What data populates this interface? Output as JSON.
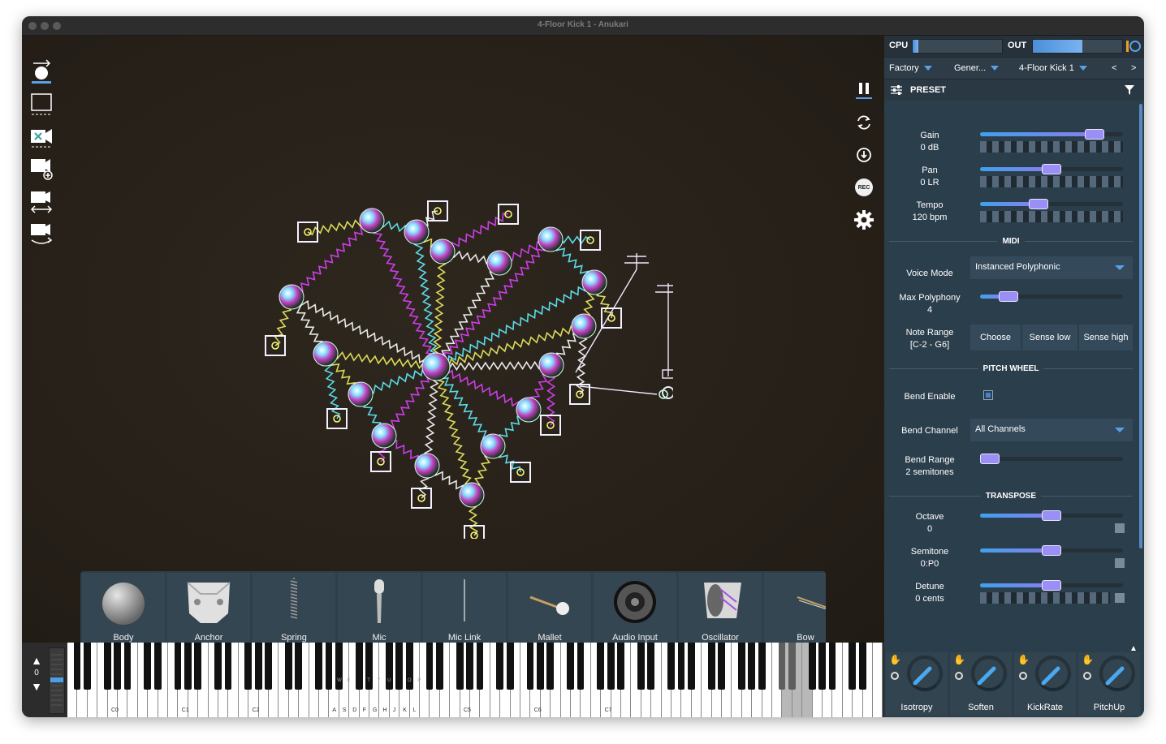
{
  "window": {
    "title": "4-Floor Kick 1 - Anukari"
  },
  "left_toolbar": {
    "items": [
      "select-tool",
      "box-select-tool",
      "camera-focus",
      "camera-add",
      "camera-pan",
      "camera-orbit"
    ]
  },
  "right_toolbar": {
    "pause_icon": "pause-icon",
    "reset_icon": "reset-icon",
    "follow_icon": "follow-icon",
    "rec_label": "REC",
    "settings_icon": "gear-icon"
  },
  "palette": {
    "items": [
      {
        "label": "Body",
        "icon": "sphere-icon"
      },
      {
        "label": "Anchor",
        "icon": "anchor-icon"
      },
      {
        "label": "Spring",
        "icon": "spring-icon"
      },
      {
        "label": "Mic",
        "icon": "mic-icon"
      },
      {
        "label": "Mic Link",
        "icon": "mic-link-icon"
      },
      {
        "label": "Mallet",
        "icon": "mallet-icon"
      },
      {
        "label": "Audio Input",
        "icon": "speaker-icon"
      },
      {
        "label": "Oscillator",
        "icon": "oscillator-icon"
      },
      {
        "label": "Bow",
        "icon": "bow-icon"
      }
    ],
    "scroll_fraction": 0.38
  },
  "keyboard": {
    "octave_value": "0",
    "octave_labels": [
      "C0",
      "C1",
      "C2",
      "C5",
      "C6",
      "C7"
    ],
    "letter_labels": [
      "A",
      "S",
      "D",
      "F",
      "G",
      "H",
      "J",
      "K",
      "L"
    ],
    "black_letter_labels": [
      "W",
      "E",
      "T",
      "Y",
      "U",
      "O",
      "P"
    ]
  },
  "side": {
    "cpu_label": "CPU",
    "out_label": "OUT",
    "cpu_level": 0.06,
    "out_level": 0.55,
    "preset_bank": "Factory",
    "preset_category": "Gener...",
    "preset_name": "4-Floor Kick 1",
    "prev_label": "<",
    "next_label": ">",
    "section_title": "PRESET",
    "gain": {
      "label": "Gain",
      "value": "0 dB",
      "fraction": 0.8
    },
    "pan": {
      "label": "Pan",
      "value": "0 LR",
      "fraction": 0.5
    },
    "tempo": {
      "label": "Tempo",
      "value": "120 bpm",
      "fraction": 0.41
    },
    "midi_header": "MIDI",
    "voice_mode": {
      "label": "Voice Mode",
      "value": "Instanced Polyphonic"
    },
    "max_polyphony": {
      "label": "Max Polyphony",
      "value": "4",
      "fraction": 0.2
    },
    "note_range": {
      "label": "Note Range",
      "value": "[C-2 - G6]",
      "choose": "Choose",
      "sense_low": "Sense low",
      "sense_high": "Sense high"
    },
    "pitch_wheel_header": "PITCH WHEEL",
    "bend_enable": {
      "label": "Bend Enable",
      "checked": true
    },
    "bend_channel": {
      "label": "Bend Channel",
      "value": "All Channels"
    },
    "bend_range": {
      "label": "Bend Range",
      "value": "2 semitones",
      "fraction": 0.0
    },
    "transpose_header": "TRANSPOSE",
    "octave": {
      "label": "Octave",
      "value": "0",
      "fraction": 0.5
    },
    "semitone": {
      "label": "Semitone",
      "value": "0:P0",
      "fraction": 0.5
    },
    "detune": {
      "label": "Detune",
      "value": "0 cents",
      "fraction": 0.5
    }
  },
  "macros": [
    {
      "label": "Isotropy"
    },
    {
      "label": "Soften"
    },
    {
      "label": "KickRate"
    },
    {
      "label": "PitchUp"
    }
  ]
}
